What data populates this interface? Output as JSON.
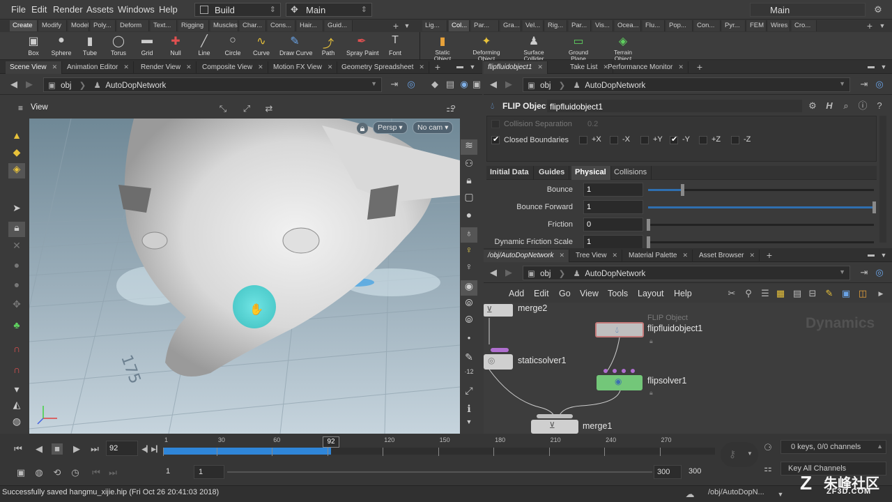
{
  "menubar": {
    "items": [
      "File",
      "Edit",
      "Render",
      "Assets",
      "Windows",
      "Help"
    ],
    "desktop_dropdown": "Build",
    "context_dropdown": "Main",
    "right_desktop": "Main"
  },
  "shelf_tabs_left": [
    "Create",
    "Modify",
    "Model",
    "Poly...",
    "Deform",
    "Text...",
    "Rigging",
    "Muscles",
    "Char...",
    "Cons...",
    "Hair...",
    "Guid..."
  ],
  "shelf_tabs_right": [
    "Lig...",
    "Col...",
    "Par...",
    "Gra...",
    "Vel...",
    "Rig...",
    "Par...",
    "Vis...",
    "Ocea...",
    "Flu...",
    "Pop...",
    "Con...",
    "Pyr...",
    "FEM",
    "Wires",
    "Cro..."
  ],
  "shelf_tools_left": [
    {
      "label": "Box",
      "icon": "box-icon"
    },
    {
      "label": "Sphere",
      "icon": "sphere-icon"
    },
    {
      "label": "Tube",
      "icon": "tube-icon"
    },
    {
      "label": "Torus",
      "icon": "torus-icon"
    },
    {
      "label": "Grid",
      "icon": "grid-icon"
    },
    {
      "label": "Null",
      "icon": "null-icon"
    },
    {
      "label": "Line",
      "icon": "line-icon"
    },
    {
      "label": "Circle",
      "icon": "circle-icon"
    },
    {
      "label": "Curve",
      "icon": "curve-icon"
    },
    {
      "label": "Draw Curve",
      "icon": "draw-curve-icon"
    },
    {
      "label": "Path",
      "icon": "path-icon"
    },
    {
      "label": "Spray Paint",
      "icon": "spray-paint-icon"
    },
    {
      "label": "Font",
      "icon": "font-icon"
    }
  ],
  "shelf_tools_right": [
    {
      "label": "Static Object",
      "icon": "static-object-icon"
    },
    {
      "label": "Deforming Object",
      "icon": "deforming-object-icon"
    },
    {
      "label": "Surface Collider",
      "icon": "surface-collider-icon"
    },
    {
      "label": "Ground Plane",
      "icon": "ground-plane-icon"
    },
    {
      "label": "Terrain Object",
      "icon": "terrain-object-icon"
    }
  ],
  "left_pane_tabs": [
    "Scene View",
    "Animation Editor",
    "Render View",
    "Composite View",
    "Motion FX View",
    "Geometry Spreadsheet"
  ],
  "right_top_tabs": [
    "flipfluidobject1",
    "Take List",
    "Performance Monitor"
  ],
  "right_bottom_tabs": [
    "/obj/AutoDopNetwork",
    "Tree View",
    "Material Palette",
    "Asset Browser"
  ],
  "path": {
    "root": "obj",
    "network": "AutoDopNetwork"
  },
  "viewport": {
    "title": "View",
    "camera_mode": "Persp",
    "camera": "No cam",
    "grid_label": "175"
  },
  "params": {
    "node_type": "FLIP Object",
    "node_name": "flipfluidobject1",
    "collision_separation_label": "Collision Separation",
    "collision_separation_value": "0.2",
    "closed_boundaries_label": "Closed Boundaries",
    "axes": [
      "+X",
      "-X",
      "+Y",
      "-Y",
      "+Z",
      "-Z"
    ],
    "sub_tabs": [
      "Initial Data",
      "Guides",
      "Physical",
      "Collisions"
    ],
    "rows": [
      {
        "label": "Bounce",
        "value": "1",
        "fill": 0.15
      },
      {
        "label": "Bounce Forward",
        "value": "1",
        "fill": 1.0
      },
      {
        "label": "Friction",
        "value": "0",
        "fill": 0.0
      },
      {
        "label": "Dynamic Friction Scale",
        "value": "1",
        "fill": 0.0
      }
    ]
  },
  "network": {
    "menu": [
      "Add",
      "Edit",
      "Go",
      "View",
      "Tools",
      "Layout",
      "Help"
    ],
    "context_label": "Dynamics",
    "nodes": [
      {
        "name": "merge2"
      },
      {
        "name": "flipfluidobject1",
        "type": "FLIP Object"
      },
      {
        "name": "staticsolver1"
      },
      {
        "name": "flipsolver1"
      },
      {
        "name": "merge1"
      }
    ]
  },
  "timeline": {
    "current_frame": "92",
    "ticks": [
      "1",
      "30",
      "60",
      "90",
      "120",
      "150",
      "180",
      "210",
      "240",
      "270"
    ],
    "playhead": "92",
    "start": "1",
    "start2": "1",
    "end": "300",
    "end2": "300",
    "keys_info": "0 keys, 0/0 channels",
    "key_all": "Key All Channels"
  },
  "status": {
    "message": "Successfully saved hangmu_xijie.hip (Fri Oct 26 20:41:03 2018)",
    "path": "/obj/AutoDopN...",
    "watermark": "朱峰社区",
    "watermark_url": "ZF3D.COM"
  },
  "colors": {
    "accent": "#2f86d9",
    "node_green": "#73c779",
    "node_red": "#c57a7a",
    "particle": "#bff5ff",
    "cursor_ring": "#2fd6d6"
  }
}
